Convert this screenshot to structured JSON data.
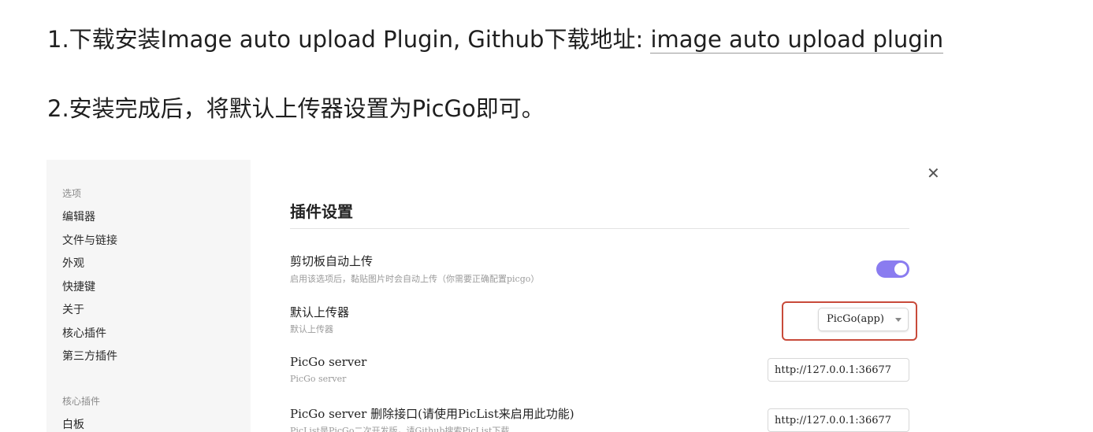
{
  "doc": {
    "line1_text": "1.下载安装Image auto upload Plugin, Github下载地址: ",
    "line1_link": "image auto upload plugin",
    "line2_text": "2.安装完成后，将默认上传器设置为PicGo即可。"
  },
  "settings": {
    "sidebar": {
      "options_heading": "选项",
      "options": [
        "编辑器",
        "文件与链接",
        "外观",
        "快捷键",
        "关于",
        "核心插件",
        "第三方插件"
      ],
      "core_heading": "核心插件",
      "core_items": [
        "白板"
      ]
    },
    "close_icon": "close-icon",
    "panel_title": "插件设置",
    "clipboard": {
      "name": "剪切板自动上传",
      "desc": "启用该选项后，黏贴图片时会自动上传（你需要正确配置picgo）",
      "enabled": true,
      "accent": "#8a7cf0"
    },
    "uploader": {
      "name": "默认上传器",
      "desc": "默认上传器",
      "value": "PicGo(app)",
      "highlight_color": "#c84a3a"
    },
    "server": {
      "name": "PicGo server",
      "desc": "PicGo server",
      "value": "http://127.0.0.1:36677"
    },
    "delete_server": {
      "name": "PicGo server 删除接口(请使用PicList来启用此功能)",
      "desc": "PicList是PicGo二次开发版，请Github搜索PicList下载",
      "value": "http://127.0.0.1:36677"
    }
  }
}
